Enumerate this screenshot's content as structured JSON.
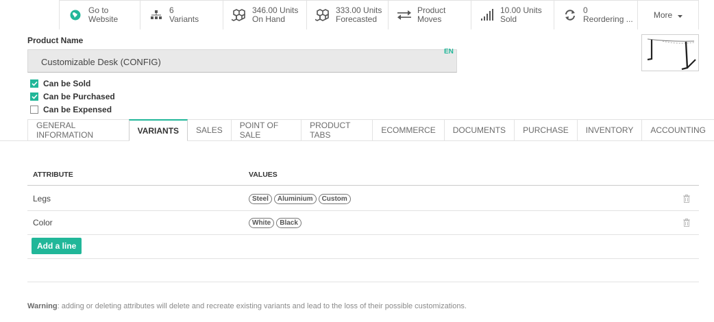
{
  "smart_buttons": [
    {
      "icon": "globe-icon",
      "value": "Go to",
      "label": "Website"
    },
    {
      "icon": "variants-icon",
      "value": "6",
      "label": "Variants"
    },
    {
      "icon": "cubes-icon",
      "value": "346.00 Units",
      "label": "On Hand"
    },
    {
      "icon": "cubes-icon",
      "value": "333.00 Units",
      "label": "Forecasted"
    },
    {
      "icon": "exchange-icon",
      "value": "Product",
      "label": "Moves"
    },
    {
      "icon": "signal-icon",
      "value": "10.00 Units",
      "label": "Sold"
    },
    {
      "icon": "refresh-icon",
      "value": "0",
      "label": "Reordering ..."
    },
    {
      "icon": "caret-down-icon",
      "value": "More",
      "label": ""
    }
  ],
  "product": {
    "name_label": "Product Name",
    "name_value": "Customizable Desk (CONFIG)",
    "lang": "EN",
    "checkboxes": [
      {
        "label": "Can be Sold",
        "checked": true
      },
      {
        "label": "Can be Purchased",
        "checked": true
      },
      {
        "label": "Can be Expensed",
        "checked": false
      }
    ]
  },
  "tabs": [
    {
      "label": "General Information",
      "active": false
    },
    {
      "label": "Variants",
      "active": true
    },
    {
      "label": "Sales",
      "active": false
    },
    {
      "label": "Point of Sale",
      "active": false
    },
    {
      "label": "Product Tabs",
      "active": false
    },
    {
      "label": "eCommerce",
      "active": false
    },
    {
      "label": "Documents",
      "active": false
    },
    {
      "label": "Purchase",
      "active": false
    },
    {
      "label": "Inventory",
      "active": false
    },
    {
      "label": "Accounting",
      "active": false
    }
  ],
  "table": {
    "headers": [
      "Attribute",
      "Values"
    ],
    "rows": [
      {
        "attribute": "Legs",
        "values": [
          "Steel",
          "Aluminium",
          "Custom"
        ]
      },
      {
        "attribute": "Color",
        "values": [
          "White",
          "Black"
        ]
      }
    ],
    "add_line_label": "Add a line"
  },
  "warning": {
    "prefix": "Warning",
    "text": ": adding or deleting attributes will delete and recreate existing variants and lead to the loss of their possible customizations."
  },
  "colors": {
    "accent": "#21b799"
  }
}
